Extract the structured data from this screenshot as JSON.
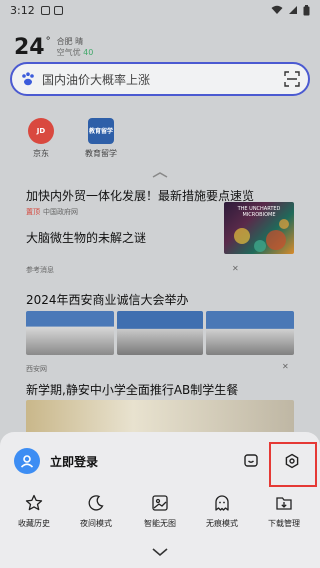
{
  "status_bar": {
    "time": "3:12"
  },
  "weather": {
    "temperature": "24",
    "degree": "°",
    "city": "合肥",
    "condition": "晴",
    "aqi_label": "空气优",
    "aqi_value": "40"
  },
  "search": {
    "query": "国内油价大概率上涨"
  },
  "apps": [
    {
      "label": "京东",
      "tile_text": "JD",
      "color": "#d9493f"
    },
    {
      "label": "教育留学",
      "tile_text": "教育留学",
      "color": "#2e5fa8"
    }
  ],
  "news": [
    {
      "title": "加快内外贸一体化发展！最新措施要点速览",
      "tag": "置顶",
      "source": "中国政府网"
    },
    {
      "title": "大脑微生物的未解之谜",
      "source": "参考消息",
      "thumb_caption": "THE UNCHARTED MICROBIOME"
    },
    {
      "title": "2024年西安商业诚信大会举办",
      "source": "西安网"
    },
    {
      "title": "新学期,静安中小学全面推行AB制学生餐"
    }
  ],
  "bottom_sheet": {
    "login_label": "立即登录",
    "menu": [
      {
        "label": "收藏历史",
        "icon": "star-icon"
      },
      {
        "label": "夜间模式",
        "icon": "moon-icon"
      },
      {
        "label": "智能无图",
        "icon": "image-icon"
      },
      {
        "label": "无痕模式",
        "icon": "ghost-icon"
      },
      {
        "label": "下载管理",
        "icon": "download-icon"
      }
    ]
  },
  "colors": {
    "accent": "#4b5ad1",
    "highlight": "#e53935",
    "avatar": "#3d8df3"
  }
}
